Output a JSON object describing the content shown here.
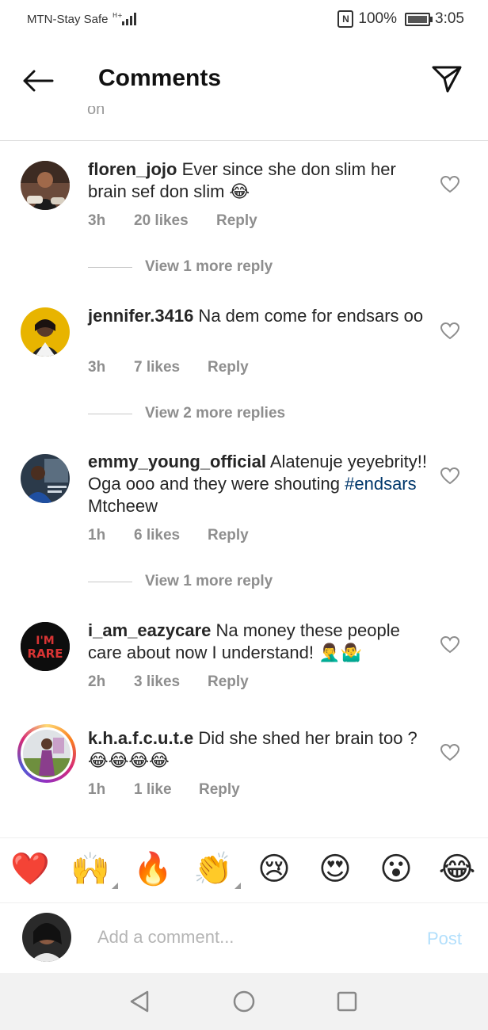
{
  "status_bar": {
    "carrier": "MTN-Stay Safe",
    "network": "H+",
    "nfc": "N",
    "battery": "100%",
    "battery_level": 1.0,
    "time": "3:05"
  },
  "header": {
    "title": "Comments",
    "back_icon": "arrow-left-icon",
    "send_icon": "paper-plane-icon"
  },
  "cut_text": "oh",
  "comments": [
    {
      "username": "floren_jojo",
      "text": " Ever since she don slim her brain sef don slim 😂",
      "time": "3h",
      "likes": "20 likes",
      "reply": "Reply",
      "view_replies": "View 1 more reply"
    },
    {
      "username": "jennifer.3416",
      "text": " Na dem come for endsars oo",
      "time": "3h",
      "likes": "7 likes",
      "reply": "Reply",
      "view_replies": "View 2 more replies"
    },
    {
      "username": "emmy_young_official",
      "text_before": " Alatenuje yeyebrity!! Oga ooo and they were shouting ",
      "hashtag": "#endsars",
      "text_after": " Mtcheew",
      "time": "1h",
      "likes": "6 likes",
      "reply": "Reply",
      "view_replies": "View 1 more reply"
    },
    {
      "username": "i_am_eazycare",
      "text": " Na money these people care about now I understand! 🤦‍♂️🤷‍♂️",
      "avatar_text_1": "I'M",
      "avatar_text_2": "RARE",
      "time": "2h",
      "likes": "3 likes",
      "reply": "Reply"
    },
    {
      "username": "k.h.a.f.c.u.t.e",
      "text": " Did she shed her brain too ?😂😂😂😂",
      "time": "1h",
      "likes": "1 like",
      "reply": "Reply"
    }
  ],
  "reactions": [
    "❤️",
    "🙌",
    "🔥",
    "👏",
    "😢",
    "😍",
    "😮",
    "😂"
  ],
  "add_comment": {
    "placeholder": "Add a comment...",
    "post_label": "Post"
  },
  "nav": {
    "back_icon": "triangle-back-icon",
    "home_icon": "circle-home-icon",
    "recents_icon": "square-recents-icon"
  },
  "colors": {
    "accent": "#0095f6",
    "post_disabled": "#b2dffc",
    "hashtag": "#00376b",
    "meta": "#8e8e8e"
  }
}
